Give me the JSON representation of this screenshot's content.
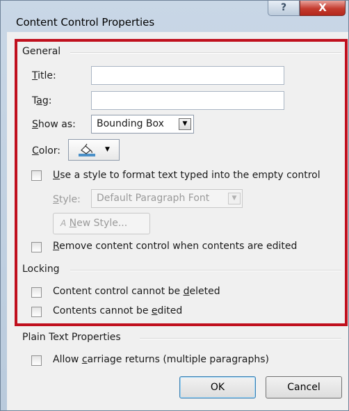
{
  "window": {
    "title": "Content Control Properties",
    "help_label": "?",
    "close_label": "X"
  },
  "general": {
    "heading": "General",
    "title_label_u": "T",
    "title_label_rest": "itle:",
    "title_value": "",
    "tag_label_pre": "T",
    "tag_label_u": "a",
    "tag_label_post": "g:",
    "tag_value": "",
    "show_as_label_u": "S",
    "show_as_label_rest": "how as:",
    "show_as_value": "Bounding Box",
    "color_label_u": "C",
    "color_label_rest": "olor:",
    "use_style_u": "U",
    "use_style_rest": "se a style to format text typed into the empty control",
    "style_label_u": "S",
    "style_label_rest": "tyle:",
    "style_value": "Default Paragraph Font",
    "new_style_glyph": "A",
    "new_style_u": "N",
    "new_style_rest": "ew Style...",
    "remove_u": "R",
    "remove_rest": "emove content control when contents are edited"
  },
  "locking": {
    "heading": "Locking",
    "cannot_delete_pre": "Content control cannot be ",
    "cannot_delete_u": "d",
    "cannot_delete_post": "eleted",
    "cannot_edit_pre": "Contents cannot be ",
    "cannot_edit_u": "e",
    "cannot_edit_post": "dited"
  },
  "plain_text": {
    "heading": "Plain Text Properties",
    "allow_cr_pre": "Allow ",
    "allow_cr_u": "c",
    "allow_cr_post": "arriage returns (multiple paragraphs)"
  },
  "buttons": {
    "ok": "OK",
    "cancel": "Cancel"
  },
  "icons": {
    "dropdown": "▼",
    "color_picker": "paint-bucket-icon"
  },
  "colors": {
    "highlight_border": "#c0101e",
    "close_button": "#c43b2e",
    "default_button_border": "#3c7fb1"
  }
}
